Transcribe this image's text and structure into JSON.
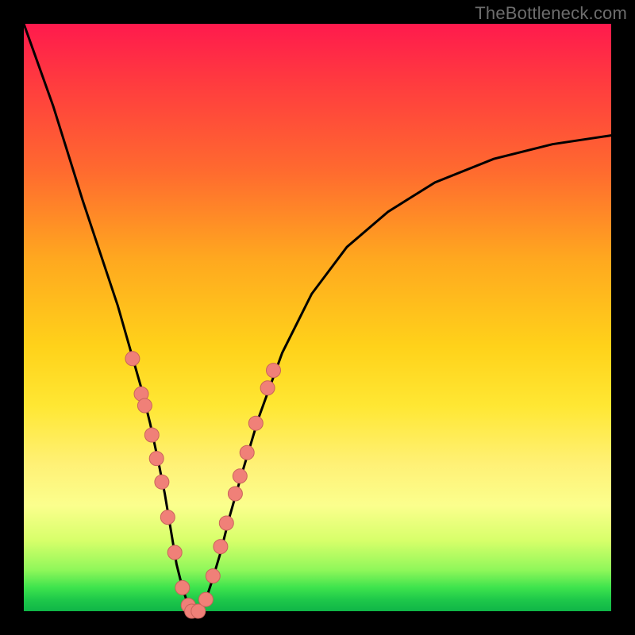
{
  "watermark": "TheBottleneck.com",
  "colors": {
    "frame": "#000000",
    "curve": "#000000",
    "marker_fill": "#f08078",
    "marker_stroke": "#c9635b",
    "gradient_stops": [
      {
        "offset": 0,
        "color": "#ff1a4d"
      },
      {
        "offset": 10,
        "color": "#ff3b3f"
      },
      {
        "offset": 25,
        "color": "#ff6a2f"
      },
      {
        "offset": 40,
        "color": "#ffa81f"
      },
      {
        "offset": 55,
        "color": "#ffd21a"
      },
      {
        "offset": 65,
        "color": "#ffe733"
      },
      {
        "offset": 75,
        "color": "#fff176"
      },
      {
        "offset": 82,
        "color": "#fbff8d"
      },
      {
        "offset": 88,
        "color": "#d7ff6a"
      },
      {
        "offset": 93,
        "color": "#8ff75a"
      },
      {
        "offset": 96,
        "color": "#3de34d"
      },
      {
        "offset": 98,
        "color": "#1fc94a"
      },
      {
        "offset": 100,
        "color": "#0fb547"
      }
    ]
  },
  "chart_data": {
    "type": "line",
    "title": "",
    "xlabel": "",
    "ylabel": "",
    "xlim": [
      0,
      100
    ],
    "ylim": [
      0,
      100
    ],
    "grid": false,
    "legend": false,
    "series": [
      {
        "name": "bottleneck-curve",
        "x": [
          0,
          5,
          10,
          13,
          16,
          18,
          20,
          21.5,
          23,
          24,
          25,
          26,
          27,
          28,
          28.6,
          29.7,
          31,
          32,
          33.5,
          35,
          37,
          40,
          44,
          49,
          55,
          62,
          70,
          80,
          90,
          100
        ],
        "y": [
          100,
          86,
          70,
          61,
          52,
          45,
          38,
          32,
          25,
          20,
          14,
          8,
          4,
          1,
          0,
          0,
          2,
          5,
          10,
          16,
          23,
          33,
          44,
          54,
          62,
          68,
          73,
          77,
          79.5,
          81
        ]
      }
    ],
    "markers": {
      "name": "highlighted-points",
      "points": [
        {
          "x": 18.5,
          "y": 43
        },
        {
          "x": 20.0,
          "y": 37
        },
        {
          "x": 20.6,
          "y": 35
        },
        {
          "x": 21.8,
          "y": 30
        },
        {
          "x": 22.6,
          "y": 26
        },
        {
          "x": 23.5,
          "y": 22
        },
        {
          "x": 24.5,
          "y": 16
        },
        {
          "x": 25.7,
          "y": 10
        },
        {
          "x": 27.0,
          "y": 4
        },
        {
          "x": 28.0,
          "y": 1
        },
        {
          "x": 28.6,
          "y": 0
        },
        {
          "x": 29.7,
          "y": 0
        },
        {
          "x": 31.0,
          "y": 2
        },
        {
          "x": 32.2,
          "y": 6
        },
        {
          "x": 33.5,
          "y": 11
        },
        {
          "x": 34.5,
          "y": 15
        },
        {
          "x": 36.0,
          "y": 20
        },
        {
          "x": 36.8,
          "y": 23
        },
        {
          "x": 38.0,
          "y": 27
        },
        {
          "x": 39.5,
          "y": 32
        },
        {
          "x": 41.5,
          "y": 38
        },
        {
          "x": 42.5,
          "y": 41
        }
      ]
    }
  }
}
